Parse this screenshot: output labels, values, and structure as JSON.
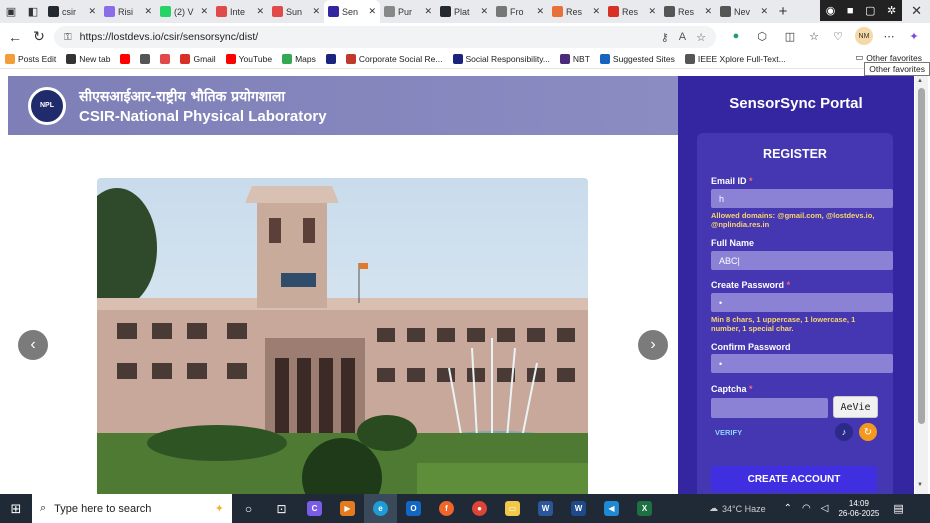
{
  "browser": {
    "tabs": [
      {
        "label": "csir",
        "icon": "github-icon",
        "color": "#24292f"
      },
      {
        "label": "Risi",
        "icon": "ai-icon",
        "color": "#8a6de9"
      },
      {
        "label": "(2) V",
        "icon": "whatsapp-icon",
        "color": "#25d366"
      },
      {
        "label": "Inte",
        "icon": "pdf-icon",
        "color": "#e04a4a"
      },
      {
        "label": "Sun",
        "icon": "pdf-icon",
        "color": "#e04a4a"
      },
      {
        "label": "Sen",
        "icon": "site-icon",
        "color": "#3326a0",
        "active": true
      },
      {
        "label": "Pur",
        "icon": "site-icon",
        "color": "#888888"
      },
      {
        "label": "Plat",
        "icon": "github-icon",
        "color": "#24292f"
      },
      {
        "label": "Fro",
        "icon": "doc-icon",
        "color": "#777777"
      },
      {
        "label": "Res",
        "icon": "research-icon",
        "color": "#e8703a"
      },
      {
        "label": "Res",
        "icon": "gmail-icon",
        "color": "#d93025"
      },
      {
        "label": "Res",
        "icon": "globe-icon",
        "color": "#555555"
      },
      {
        "label": "Nev",
        "icon": "mail-icon",
        "color": "#555555"
      }
    ],
    "new_tab": "+",
    "url": "https://lostdevs.io/csir/sensorsync/dist/",
    "profile_initials": "NM"
  },
  "bookmarks": [
    {
      "label": "Posts Edit",
      "color": "#f29d38"
    },
    {
      "label": "New tab",
      "color": "#333333"
    },
    {
      "label": "",
      "color": "#ff0000"
    },
    {
      "label": "",
      "color": "#555555"
    },
    {
      "label": "",
      "color": "#e04a4a"
    },
    {
      "label": "Gmail",
      "color": "#d93025"
    },
    {
      "label": "YouTube",
      "color": "#ff0000"
    },
    {
      "label": "Maps",
      "color": "#34a853"
    },
    {
      "label": "",
      "color": "#1a237e"
    },
    {
      "label": "Corporate Social Re...",
      "color": "#c0392b"
    },
    {
      "label": "Social Responsibility...",
      "color": "#1a237e"
    },
    {
      "label": "NBT",
      "color": "#4a2a7a"
    },
    {
      "label": "Suggested Sites",
      "color": "#1565c0"
    },
    {
      "label": "IEEE Xplore Full-Text...",
      "color": "#555555"
    }
  ],
  "other_favorites": "Other favorites",
  "tooltip": "Other favorites",
  "header": {
    "hindi_name": "सीएसआईआर-राष्ट्रीय भौतिक प्रयोगशाला",
    "english_name": "CSIR-National Physical Laboratory"
  },
  "carousel": {
    "prev": "‹",
    "next": "›"
  },
  "portal": {
    "title": "SensorSync Portal",
    "form_title": "REGISTER",
    "email_label": "Email ID",
    "email_value": "h",
    "email_hint": "Allowed domains: @gmail.com, @lostdevs.io, @nplindia.res.in",
    "name_label": "Full Name",
    "name_value": "ABC|",
    "password_label": "Create Password",
    "password_value": "•",
    "password_hint": "Min 8 chars, 1 uppercase, 1 lowercase, 1 number, 1 special char.",
    "confirm_label": "Confirm Password",
    "confirm_value": "•",
    "captcha_label": "Captcha",
    "captcha_code": "AeVie",
    "verify": "VERIFY",
    "create_button": "CREATE ACCOUNT",
    "required_mark": "*"
  },
  "taskbar": {
    "search_placeholder": "Type here to search",
    "weather": "34°C  Haze",
    "time": "14:09",
    "date": "26-06-2025"
  }
}
